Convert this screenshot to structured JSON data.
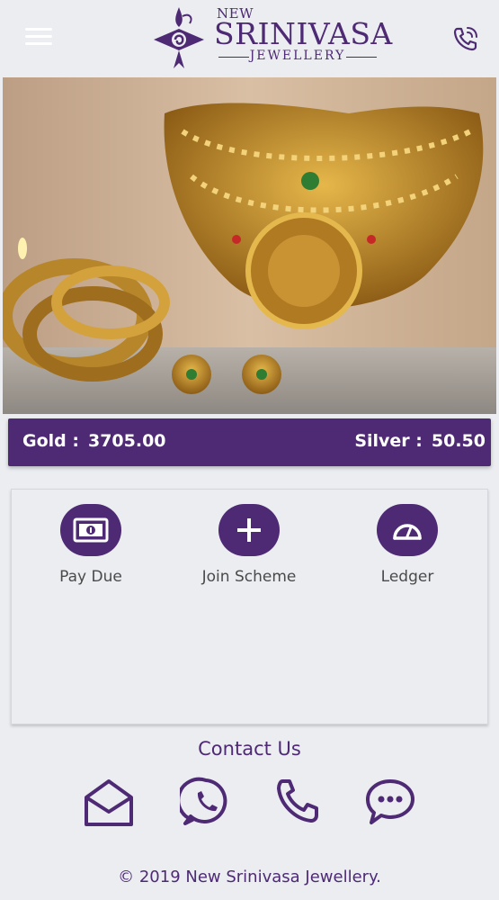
{
  "header": {
    "menu_icon": "hamburger-menu-icon",
    "logo": {
      "top": "NEW",
      "main": "SRINIVASA",
      "sub": "JEWELLERY"
    },
    "call_icon": "phone-ringing-icon"
  },
  "banner": {
    "description": "jewellery-banner-image"
  },
  "rates": {
    "gold_label": "Gold :",
    "gold_value": "3705.00",
    "silver_label": "Silver :",
    "silver_value": "50.50"
  },
  "actions": [
    {
      "label": "Pay Due",
      "icon": "banknote-icon"
    },
    {
      "label": "Join Scheme",
      "icon": "plus-icon"
    },
    {
      "label": "Ledger",
      "icon": "gauge-icon"
    }
  ],
  "contact": {
    "title": "Contact Us",
    "icons": [
      "envelope-open-icon",
      "whatsapp-icon",
      "phone-icon",
      "chat-bubble-icon"
    ]
  },
  "footer": {
    "text": "© 2019  New Srinivasa Jewellery."
  },
  "colors": {
    "brand": "#4e2a74",
    "background": "#ebedf1",
    "gold": "#c79a2e"
  }
}
